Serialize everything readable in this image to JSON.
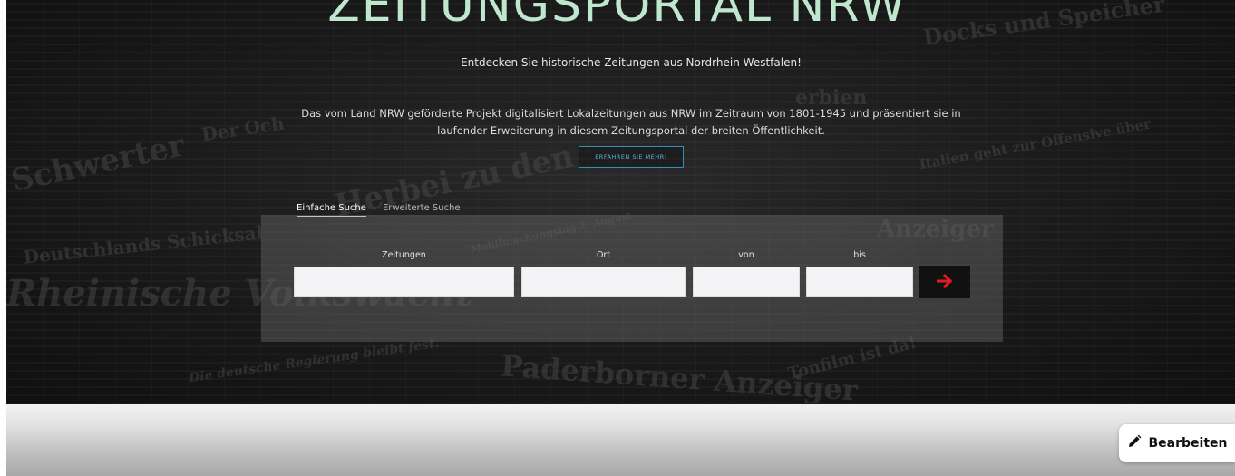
{
  "hero": {
    "title": "ZEITUNGSPORTAL NRW",
    "subtitle": "Entdecken Sie historische Zeitungen aus Nordrhein-Westfalen!",
    "description_line1": "Das vom Land NRW geförderte Projekt digitalisiert Lokalzeitungen aus NRW im Zeitraum von 1801-1945 und präsentiert sie in",
    "description_line2": "laufender Erweiterung in diesem Zeitungsportal der breiten Öffentlichkeit.",
    "more_button": "ERFAHREN SIE MEHR!",
    "background_words": [
      "Docks und Speicher",
      "Schwerter",
      "Herbei zu den",
      "Deutschlands Schicksal",
      "Rheinische Volkswacht",
      "Paderborner Anzeiger",
      "Italien geht zur Offensive über",
      "Anzeiger",
      "Der Och",
      "Die deutsche Regierung bleibt fest.",
      "Tonfilm ist da!",
      "Mobilmachungstag 2. August",
      "erbien"
    ]
  },
  "search": {
    "tabs": [
      {
        "label": "Einfache Suche",
        "active": true
      },
      {
        "label": "Erweiterte Suche",
        "active": false
      }
    ],
    "fields": {
      "newspapers": {
        "label": "Zeitungen",
        "value": ""
      },
      "place": {
        "label": "Ort",
        "value": ""
      },
      "from": {
        "label": "von",
        "value": ""
      },
      "to": {
        "label": "bis",
        "value": ""
      }
    },
    "submit_icon": "arrow-right-icon"
  },
  "footer": {
    "edit_button": "Bearbeiten",
    "edit_icon": "pencil-icon"
  },
  "colors": {
    "title": "#bfe7cd",
    "accent_link": "#56b6e4",
    "submit_arrow": "#e31b23"
  }
}
